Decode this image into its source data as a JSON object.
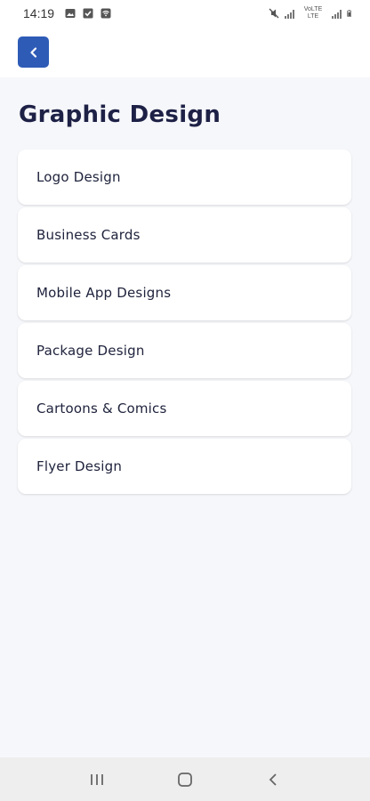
{
  "status_bar": {
    "time": "14:19",
    "network_label": "VoLTE LTE"
  },
  "header": {
    "back_icon": "chevron-left-icon"
  },
  "page": {
    "title": "Graphic Design"
  },
  "categories": [
    {
      "label": "Logo Design"
    },
    {
      "label": "Business Cards"
    },
    {
      "label": "Mobile App Designs"
    },
    {
      "label": "Package Design"
    },
    {
      "label": "Cartoons & Comics"
    },
    {
      "label": "Flyer Design"
    }
  ],
  "colors": {
    "accent": "#2e5bb6",
    "background": "#f6f7fa",
    "card": "#ffffff",
    "text": "#1e2146"
  }
}
